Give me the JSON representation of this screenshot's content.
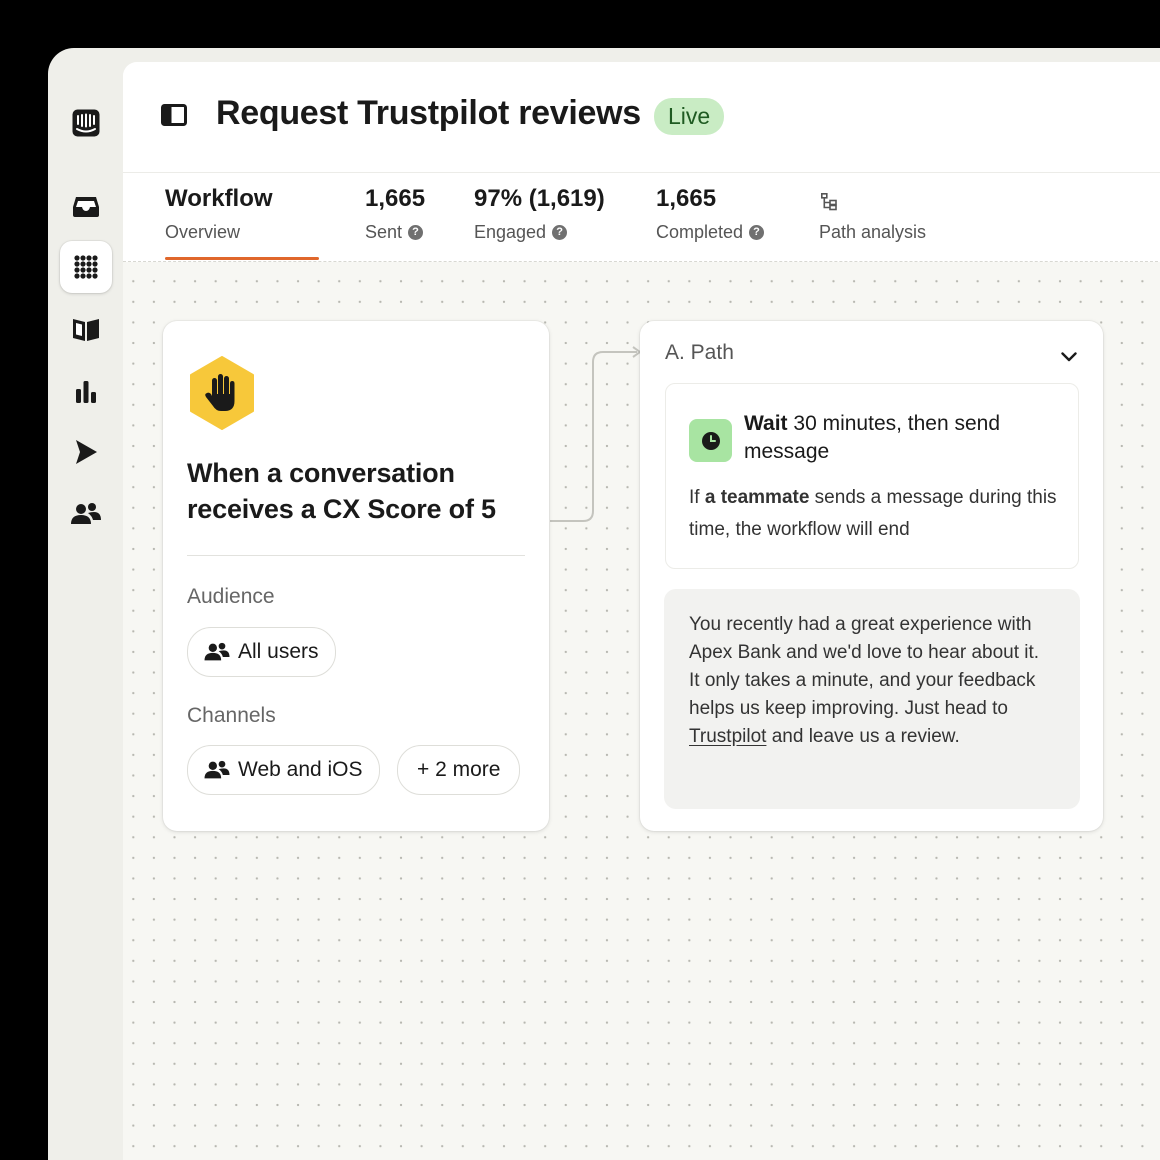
{
  "sidebar": {
    "items": [
      {
        "name": "logo-icon"
      },
      {
        "name": "inbox-icon"
      },
      {
        "name": "apps-grid-icon",
        "active": true
      },
      {
        "name": "book-icon"
      },
      {
        "name": "bar-chart-icon"
      },
      {
        "name": "send-arrow-icon"
      },
      {
        "name": "users-icon"
      }
    ]
  },
  "header": {
    "title": "Request Trustpilot reviews",
    "status": "Live"
  },
  "tabs": {
    "workflow": {
      "title": "Workflow",
      "subtitle": "Overview"
    },
    "sent": {
      "value": "1,665",
      "label": "Sent"
    },
    "engaged": {
      "value": "97% (1,619)",
      "label": "Engaged"
    },
    "completed": {
      "value": "1,665",
      "label": "Completed"
    },
    "path_analysis": {
      "label": "Path analysis"
    }
  },
  "trigger": {
    "title": "When a conversation receives a CX Score of 5",
    "audience_label": "Audience",
    "audience_value": "All users",
    "channels_label": "Channels",
    "channels_value": "Web and iOS",
    "channels_more": "+ 2 more"
  },
  "path": {
    "header": "A. Path",
    "wait_bold": "Wait",
    "wait_rest": " 30 minutes, then send message",
    "note_prefix": "If ",
    "note_bold": "a teammate",
    "note_suffix": " sends a message during this time, the workflow will end",
    "message_before": "You recently had a great experience with Apex Bank and we'd love to hear about it. It only takes a minute, and your feedback helps us keep improving. Just head to ",
    "message_link": "Trustpilot",
    "message_after": " and leave us a review."
  },
  "colors": {
    "accent_underline": "#e0672b",
    "live_badge_bg": "#c9ecc4",
    "trigger_hex": "#f7c83a",
    "clock_bg": "#a8e4a2"
  }
}
